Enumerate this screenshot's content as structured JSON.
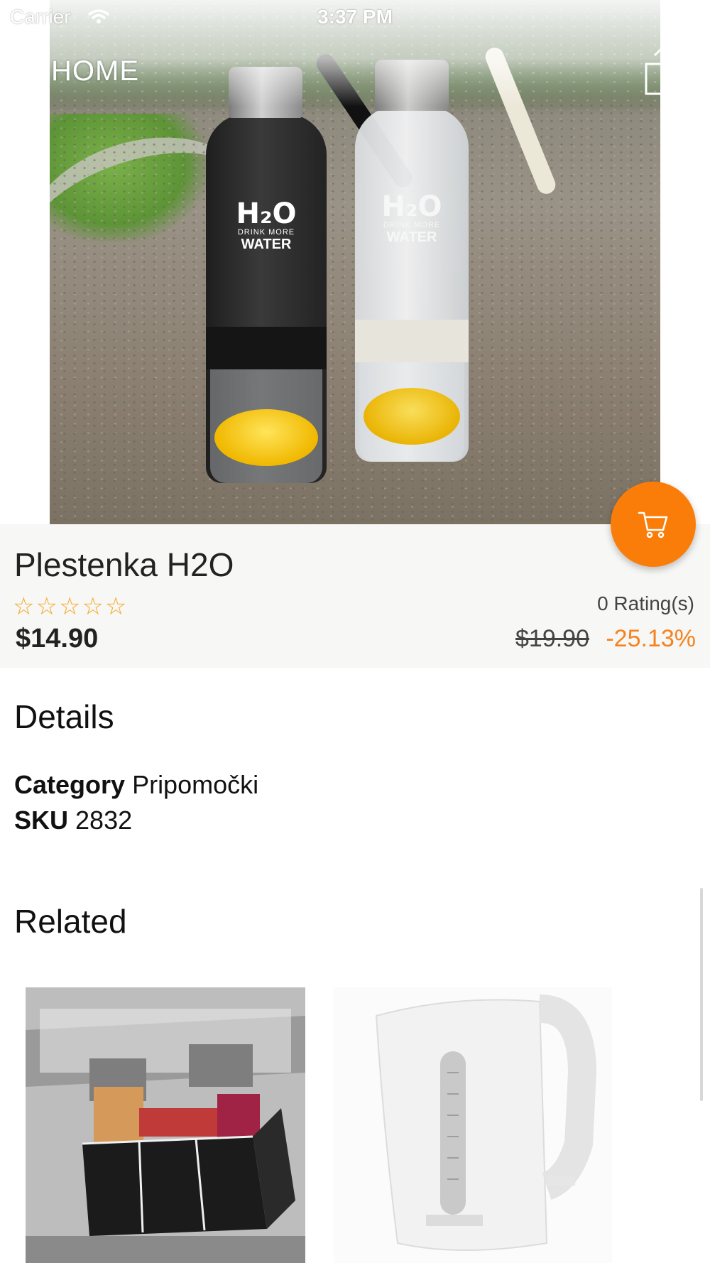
{
  "status_bar": {
    "carrier": "Carrier",
    "time": "3:37 PM"
  },
  "nav": {
    "back_label": "HOME"
  },
  "product": {
    "title": "Plestenka H2O",
    "stars": "☆☆☆☆☆",
    "rating_value": 0,
    "ratings_text": "0 Rating(s)",
    "price": "$14.90",
    "old_price": "$19.90",
    "discount": "-25.13%"
  },
  "details": {
    "heading": "Details",
    "category_label": "Category",
    "category_value": "Pripomočki",
    "sku_label": "SKU",
    "sku_value": "2832"
  },
  "related": {
    "heading": "Related"
  },
  "colors": {
    "accent": "#fb7d09",
    "discount": "#f58220",
    "star": "#f5a623",
    "info_bg": "#f7f7f5"
  },
  "icons": {
    "back": "chevron-left-icon",
    "share": "share-icon",
    "cart": "cart-icon",
    "wifi": "wifi-icon",
    "battery": "battery-icon"
  }
}
